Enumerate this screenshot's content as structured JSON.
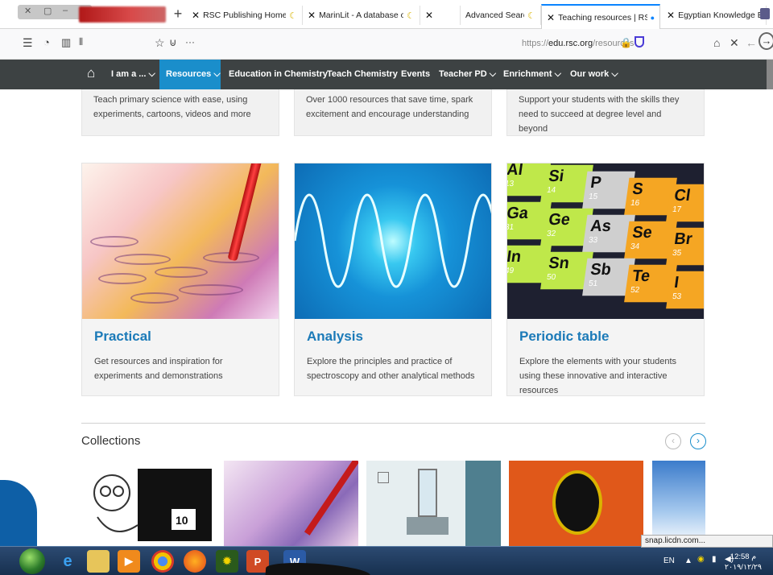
{
  "browser": {
    "tabs": [
      {
        "label": "RSC Publishing Home – Chemi"
      },
      {
        "label": "MarinLit - A database of the m"
      },
      {
        "label": ""
      },
      {
        "label": "Advanced Search"
      },
      {
        "label": "Teaching resources | RSC Educ"
      },
      {
        "label": "Egyptian Knowledge Bank - Sc"
      }
    ],
    "url_prefix": "https://",
    "url_domain": "edu.rsc.org",
    "url_path": "/resources",
    "ellipsis": "···"
  },
  "site_nav": {
    "items": [
      "I am a ...",
      "Resources",
      "Education in Chemistry",
      "Teach Chemistry",
      "Events",
      "Teacher PD",
      "Enrichment",
      "Our work"
    ],
    "chev": "⌵"
  },
  "top_cards": [
    {
      "desc": "Teach primary science with ease, using experiments, cartoons, videos and more"
    },
    {
      "desc": "Over 1000 resources that save time, spark excitement and encourage understanding"
    },
    {
      "desc": "Support your students with the skills they need to succeed at degree level and beyond"
    }
  ],
  "cards": [
    {
      "title": "Practical",
      "desc": "Get resources and inspiration for experiments and demonstrations"
    },
    {
      "title": "Analysis",
      "desc": "Explore the principles and practice of spectroscopy and other analytical methods"
    },
    {
      "title": "Periodic table",
      "desc": "Explore the elements with your students using these innovative and interactive resources"
    }
  ],
  "periodic_elements": [
    {
      "sym": "Al",
      "num": "13",
      "color": "#bfe84a"
    },
    {
      "sym": "Si",
      "num": "14",
      "color": "#bfe84a"
    },
    {
      "sym": "P",
      "num": "15",
      "color": "#cfcfcf"
    },
    {
      "sym": "S",
      "num": "16",
      "color": "#f5a623"
    },
    {
      "sym": "Cl",
      "num": "17",
      "color": "#f5a623"
    },
    {
      "sym": "Ga",
      "num": "31",
      "color": "#bfe84a"
    },
    {
      "sym": "Ge",
      "num": "32",
      "color": "#bfe84a"
    },
    {
      "sym": "As",
      "num": "33",
      "color": "#cfcfcf"
    },
    {
      "sym": "Se",
      "num": "34",
      "color": "#f5a623"
    },
    {
      "sym": "Br",
      "num": "35",
      "color": "#f5a623"
    },
    {
      "sym": "In",
      "num": "49",
      "color": "#bfe84a"
    },
    {
      "sym": "Sn",
      "num": "50",
      "color": "#bfe84a"
    },
    {
      "sym": "Sb",
      "num": "51",
      "color": "#cfcfcf"
    },
    {
      "sym": "Te",
      "num": "52",
      "color": "#f5a623"
    },
    {
      "sym": "I",
      "num": "53",
      "color": "#f5a623"
    }
  ],
  "collections": {
    "title": "Collections",
    "prev": "‹",
    "next": "›",
    "thumb_badge": "10"
  },
  "taskbar": {
    "lang": "EN",
    "time": "12:58 م",
    "date": "٢٠١٩/١٢/٢٩",
    "tooltip": "snap.licdn.com..."
  }
}
